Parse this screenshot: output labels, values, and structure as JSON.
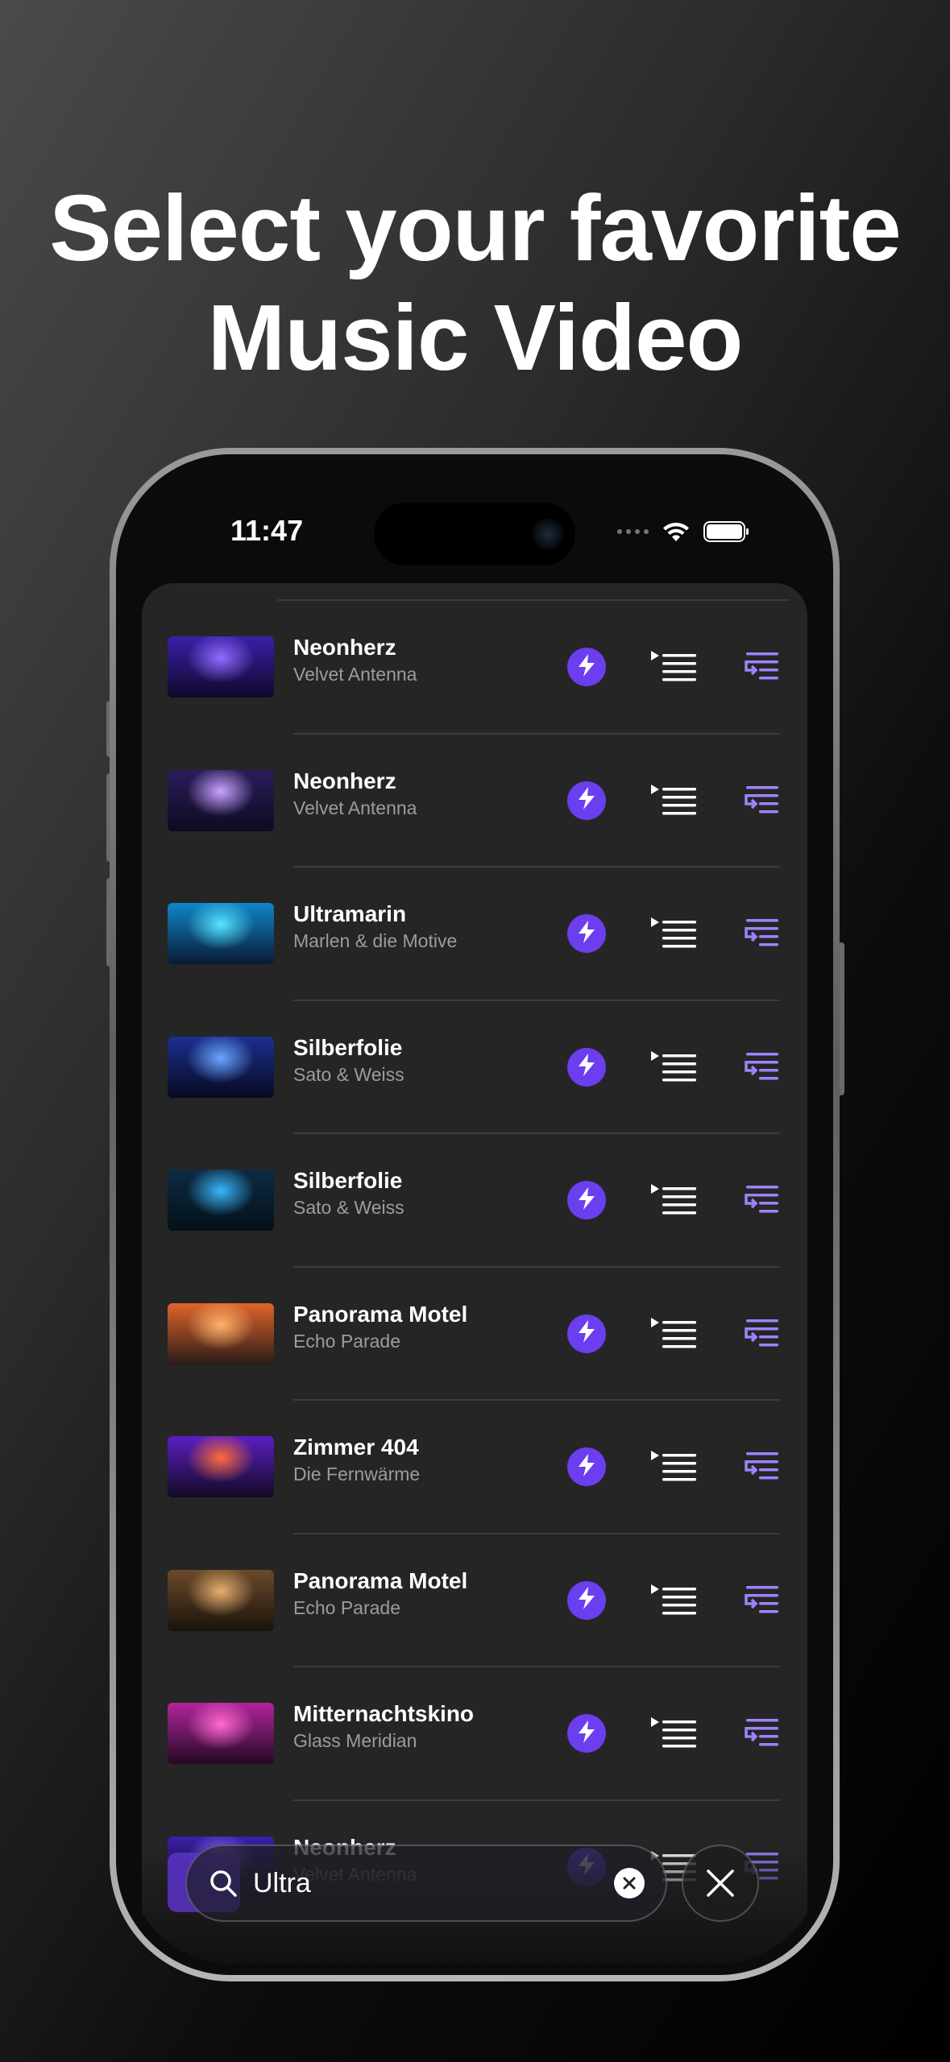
{
  "headline": {
    "line1": "Select your favorite",
    "line2": "Music Video"
  },
  "status_bar": {
    "time": "11:47"
  },
  "colors": {
    "accent": "#6b3ef0",
    "accent_light": "#9f82ff",
    "sheet_bg": "#252525"
  },
  "icons": {
    "row_action_1": "bolt-icon",
    "row_action_2": "play-next-icon",
    "row_action_3": "add-to-queue-icon"
  },
  "results": [
    {
      "title": "Neonherz",
      "artist": "Velvet Antenna",
      "thumb_colors": [
        "#3b1fa8",
        "#8f6cff",
        "#10082a"
      ]
    },
    {
      "title": "Neonherz",
      "artist": "Velvet Antenna",
      "thumb_colors": [
        "#2a1c5a",
        "#c9a4ff",
        "#0e0b22"
      ]
    },
    {
      "title": "Ultramarin",
      "artist": "Marlen & die Motive",
      "thumb_colors": [
        "#0f86c9",
        "#56e4ff",
        "#0a1b33"
      ]
    },
    {
      "title": "Silberfolie",
      "artist": "Sato & Weiss",
      "thumb_colors": [
        "#1b2f8f",
        "#6aa6ff",
        "#070a20"
      ]
    },
    {
      "title": "Silberfolie",
      "artist": "Sato & Weiss",
      "thumb_colors": [
        "#0d2b44",
        "#3ab7ff",
        "#041018"
      ]
    },
    {
      "title": "Panorama Motel",
      "artist": "Echo Parade",
      "thumb_colors": [
        "#e0642b",
        "#ffb36b",
        "#2a1b18"
      ]
    },
    {
      "title": "Zimmer 404",
      "artist": "Die Fernwärme",
      "thumb_colors": [
        "#5a1ec2",
        "#ff6a3b",
        "#120a24"
      ]
    },
    {
      "title": "Panorama Motel",
      "artist": "Echo Parade",
      "thumb_colors": [
        "#6b4a2a",
        "#e6b070",
        "#1a120c"
      ]
    },
    {
      "title": "Mitternachtskino",
      "artist": "Glass Meridian",
      "thumb_colors": [
        "#b0249a",
        "#ff6ad0",
        "#240a24"
      ]
    },
    {
      "title": "Neonherz",
      "artist": "Velvet Antenna",
      "thumb_colors": [
        "#3b1fa8",
        "#8f6cff",
        "#10082a"
      ]
    }
  ],
  "search": {
    "value": "Ultra"
  }
}
